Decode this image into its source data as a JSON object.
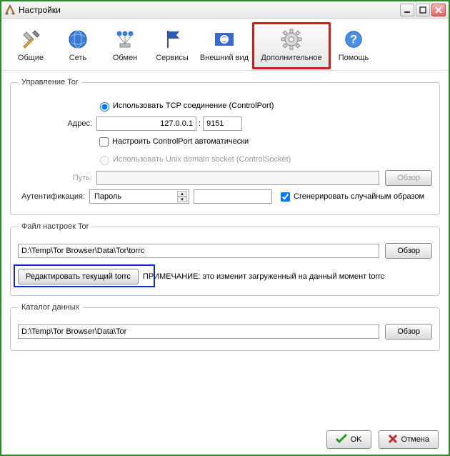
{
  "window": {
    "title": "Настройки"
  },
  "toolbar": {
    "items": [
      {
        "id": "general",
        "label": "Общие"
      },
      {
        "id": "network",
        "label": "Сеть"
      },
      {
        "id": "exchange",
        "label": "Обмен"
      },
      {
        "id": "services",
        "label": "Сервисы"
      },
      {
        "id": "appearance",
        "label": "Внешний вид"
      },
      {
        "id": "advanced",
        "label": "Дополнительное"
      },
      {
        "id": "help",
        "label": "Помощь"
      }
    ]
  },
  "tor_control": {
    "legend": "Управление Tor",
    "use_tcp": {
      "label": "Использовать TCP соединение (ControlPort)",
      "checked": true
    },
    "address_label": "Адрес:",
    "address_host": "127.0.0.1",
    "address_sep": ":",
    "address_port": "9151",
    "auto_cp": {
      "label": "Настроить ControlPort автоматически",
      "checked": false
    },
    "use_socket": {
      "label": "Использовать Unix domain socket (ControlSocket)",
      "checked": false
    },
    "path_label": "Путь:",
    "path_value": "",
    "browse": "Обзор",
    "auth_label": "Аутентификация:",
    "auth_mode": "Пароль",
    "auth_value": "",
    "random": {
      "label": "Сгенерировать случайным образом",
      "checked": true
    }
  },
  "torrc": {
    "legend": "Файл настроек Tor",
    "path": "D:\\Temp\\Tor Browser\\Data\\Tor\\torrc",
    "browse": "Обзор",
    "edit_btn": "Редактировать текущий torrc",
    "note": "ПРИМЕЧАНИЕ: это изменит загруженный на данный момент torrc"
  },
  "datadir": {
    "legend": "Каталог данных",
    "path": "D:\\Temp\\Tor Browser\\Data\\Tor",
    "browse": "Обзор"
  },
  "footer": {
    "ok": "OK",
    "cancel": "Отмена"
  }
}
